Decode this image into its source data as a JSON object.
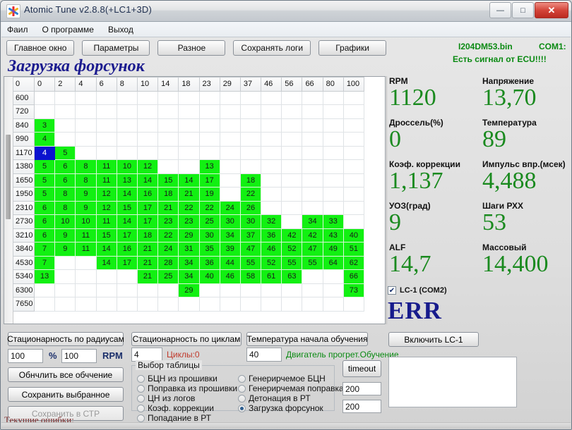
{
  "window": {
    "title": "Atomic Tune  v2.8.8(+LC1+3D)",
    "icon": "asterisk-star-icon",
    "buttons": {
      "minimize": "—",
      "maximize": "□",
      "close": "✕"
    }
  },
  "menu": {
    "items": [
      "Фаил",
      "О программе",
      "Выход"
    ]
  },
  "toolbar": {
    "buttons": [
      "Главное окно",
      "Параметры",
      "Разное",
      "Сохранять логи",
      "Графики"
    ]
  },
  "header": {
    "bin_name": "I204DM53.bin",
    "com_port": "COM1:",
    "ecu_signal": "Есть сигнал от ECU!!!!",
    "page_title": "Загрузка форсунок"
  },
  "chart_data": {
    "type": "heatmap",
    "title": "Загрузка форсунок",
    "corner_label": "0",
    "xlabel": "",
    "ylabel": "",
    "categories": [
      "0",
      "2",
      "4",
      "6",
      "8",
      "10",
      "14",
      "18",
      "23",
      "29",
      "37",
      "46",
      "56",
      "66",
      "80",
      "100"
    ],
    "rows": [
      "600",
      "720",
      "840",
      "990",
      "1170",
      "1380",
      "1650",
      "1950",
      "2310",
      "2730",
      "3210",
      "3840",
      "4530",
      "5340",
      "6300",
      "7650"
    ],
    "selected_cell": {
      "row": "1170",
      "col": "0",
      "value": "4"
    },
    "values": [
      [
        null,
        null,
        null,
        null,
        null,
        null,
        null,
        null,
        null,
        null,
        null,
        null,
        null,
        null,
        null,
        null
      ],
      [
        null,
        null,
        null,
        null,
        null,
        null,
        null,
        null,
        null,
        null,
        null,
        null,
        null,
        null,
        null,
        null
      ],
      [
        3,
        null,
        null,
        null,
        null,
        null,
        null,
        null,
        null,
        null,
        null,
        null,
        null,
        null,
        null,
        null
      ],
      [
        4,
        null,
        null,
        null,
        null,
        null,
        null,
        null,
        null,
        null,
        null,
        null,
        null,
        null,
        null,
        null
      ],
      [
        4,
        5,
        null,
        null,
        null,
        null,
        null,
        null,
        null,
        null,
        null,
        null,
        null,
        null,
        null,
        null
      ],
      [
        5,
        6,
        8,
        11,
        10,
        12,
        null,
        null,
        13,
        null,
        null,
        null,
        null,
        null,
        null,
        null
      ],
      [
        5,
        6,
        8,
        11,
        13,
        14,
        15,
        14,
        17,
        null,
        18,
        null,
        null,
        null,
        null,
        null
      ],
      [
        5,
        8,
        9,
        12,
        14,
        16,
        18,
        21,
        19,
        null,
        22,
        null,
        null,
        null,
        null,
        null
      ],
      [
        6,
        8,
        9,
        12,
        15,
        17,
        21,
        22,
        22,
        24,
        26,
        null,
        null,
        null,
        null,
        null
      ],
      [
        6,
        10,
        10,
        11,
        14,
        17,
        23,
        23,
        25,
        30,
        30,
        32,
        null,
        34,
        33,
        null
      ],
      [
        6,
        9,
        11,
        15,
        17,
        18,
        22,
        29,
        30,
        34,
        37,
        36,
        42,
        42,
        43,
        40
      ],
      [
        7,
        9,
        11,
        14,
        16,
        21,
        24,
        31,
        35,
        39,
        47,
        46,
        52,
        47,
        49,
        51
      ],
      [
        7,
        null,
        null,
        14,
        17,
        21,
        28,
        34,
        36,
        44,
        55,
        52,
        55,
        55,
        64,
        62
      ],
      [
        13,
        null,
        null,
        null,
        null,
        21,
        25,
        34,
        40,
        46,
        58,
        61,
        63,
        null,
        null,
        66
      ],
      [
        null,
        null,
        null,
        null,
        null,
        null,
        null,
        29,
        null,
        null,
        null,
        null,
        null,
        null,
        null,
        73
      ],
      [
        null,
        null,
        null,
        null,
        null,
        null,
        null,
        null,
        null,
        null,
        null,
        null,
        null,
        null,
        null,
        null
      ]
    ],
    "colors": {
      "filled": "#12f012",
      "empty": "#ffffff",
      "selected": "#0a12cf"
    }
  },
  "readouts": [
    {
      "label": "RPM",
      "value": "1120"
    },
    {
      "label": "Напряжение",
      "value": "13,70"
    },
    {
      "label": "Дроссель(%)",
      "value": "0"
    },
    {
      "label": "Температура",
      "value": "89"
    },
    {
      "label": "Коэф. коррекции",
      "value": "1,137"
    },
    {
      "label": "Импульс впр.(мсек)",
      "value": "4,488"
    },
    {
      "label": "УОЗ(град)",
      "value": "9"
    },
    {
      "label": "Шаги РХХ",
      "value": "53"
    },
    {
      "label": "ALF",
      "value": "14,7"
    },
    {
      "label": "Массовый",
      "value": "14,400"
    }
  ],
  "lc1": {
    "checkbox_label": "LC-1 (COM2)",
    "checked": true,
    "check_glyph": "✔",
    "error_text": "ERR",
    "enable_button": "Включить LC-1"
  },
  "bottom": {
    "stationarity_radius_button": "Стационарность по радиусам",
    "stationarity_cycles_button": "Стационарность по циклам",
    "temp_start_button": "Температура начала обучения",
    "percent_input": "100",
    "percent_sign": "%",
    "rpm_input": "100",
    "rpm_label": "RPM",
    "cycles_input": "4",
    "cycles_label": "Циклы:0",
    "temp_input": "40",
    "engine_warm_label": "Двигатель прогрет.Обучение",
    "reset_button": "Обнчлить все обччение",
    "save_selected_button": "Сохранить выбранное",
    "save_ctp_button": "Сохранить в СТР",
    "timeout_button": "timeout",
    "timeout_input_1": "200",
    "timeout_input_2": "200",
    "errors_label": "Текущие ошибки:"
  },
  "table_select": {
    "title": "Выбор таблицы",
    "left_options": [
      "БЦН из прошивки",
      "Поправка из прошивки",
      "ЦН из логов",
      "Коэф. коррекции",
      "Попадание в РТ"
    ],
    "right_options": [
      "Генерирчемое БЦН",
      "Генерирчемая поправка",
      "Детонация в РТ",
      "Загрузка форсунок"
    ],
    "selected": "Загрузка форсунок"
  }
}
